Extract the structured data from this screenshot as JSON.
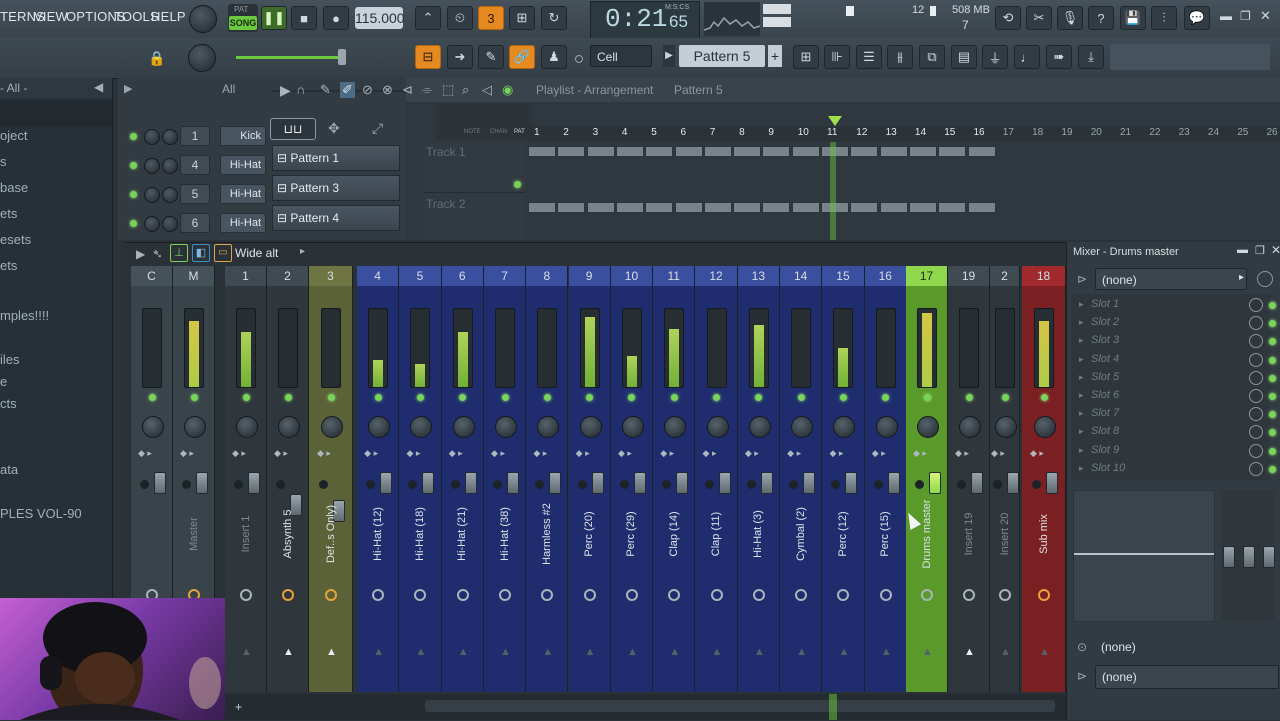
{
  "menu": [
    "TERNS",
    "VIEW",
    "OPTIONS",
    "TOOLS",
    "HELP"
  ],
  "transport": {
    "pat": "PAT",
    "song": "SONG",
    "tempo": "115.000",
    "time": "0:21",
    "time_sub": "65",
    "time_unit": "M:S:CS"
  },
  "cpu": {
    "val1": "12",
    "mem": "508 MB",
    "val2": "7"
  },
  "toolbar2": {
    "snap": "Cell",
    "pattern": "Pattern 5",
    "plus": "+"
  },
  "browser": {
    "header": "- All -",
    "items": [
      "oject",
      "s",
      "base",
      "ets",
      "esets",
      "ets",
      "mples!!!!",
      "iles",
      "e",
      "cts",
      "ata",
      "PLES VOL-90"
    ]
  },
  "rack": {
    "filter": "All",
    "channels": [
      {
        "num": "1",
        "name": "Kick"
      },
      {
        "num": "4",
        "name": "Hi-Hat"
      },
      {
        "num": "5",
        "name": "Hi-Hat"
      },
      {
        "num": "6",
        "name": "Hi-Hat"
      }
    ]
  },
  "patterns": [
    "Pattern 1",
    "Pattern 3",
    "Pattern 4"
  ],
  "playlist": {
    "title": "Playlist - Arrangement",
    "pattern": "Pattern 5",
    "tracks": [
      "Track 1",
      "Track 2"
    ],
    "bars": [
      "1",
      "2",
      "3",
      "4",
      "5",
      "6",
      "7",
      "8",
      "9",
      "10",
      "11",
      "12",
      "13",
      "14",
      "15",
      "16",
      "17",
      "18",
      "19",
      "20",
      "21",
      "22",
      "23",
      "24",
      "25",
      "26"
    ],
    "mini": [
      "NOTE",
      "CHAN",
      "PAT"
    ]
  },
  "mixer": {
    "preset": "Wide alt",
    "title": "Mixer - Drums master",
    "fx_none": "(none)",
    "slots": [
      "Slot 1",
      "Slot 2",
      "Slot 3",
      "Slot 4",
      "Slot 5",
      "Slot 6",
      "Slot 7",
      "Slot 8",
      "Slot 9",
      "Slot 10"
    ],
    "out_none1": "(none)",
    "out_none2": "(none)",
    "tracks": [
      {
        "hdr": "C",
        "label": ""
      },
      {
        "hdr": "M",
        "label": "Master"
      },
      {
        "hdr": "1",
        "label": "Insert 1"
      },
      {
        "hdr": "2",
        "label": "Absynth 5"
      },
      {
        "hdr": "3",
        "label": "Def..s Only)"
      },
      {
        "hdr": "4",
        "label": "Hi-Hat (12)"
      },
      {
        "hdr": "5",
        "label": "Hi-Hat (18)"
      },
      {
        "hdr": "6",
        "label": "Hi-Hat (21)"
      },
      {
        "hdr": "7",
        "label": "Hi-Hat (38)"
      },
      {
        "hdr": "8",
        "label": "Harmless #2"
      },
      {
        "hdr": "9",
        "label": "Perc (20)"
      },
      {
        "hdr": "10",
        "label": "Perc (29)"
      },
      {
        "hdr": "11",
        "label": "Clap (14)"
      },
      {
        "hdr": "12",
        "label": "Clap (11)"
      },
      {
        "hdr": "13",
        "label": "Hi-Hat (3)"
      },
      {
        "hdr": "14",
        "label": "Cymbal (2)"
      },
      {
        "hdr": "15",
        "label": "Perc (12)"
      },
      {
        "hdr": "16",
        "label": "Perc (15)"
      },
      {
        "hdr": "17",
        "label": "Drums master"
      },
      {
        "hdr": "19",
        "label": "Insert 19"
      },
      {
        "hdr": "2",
        "label": "Insert 20"
      },
      {
        "hdr": "18",
        "label": "Sub mix"
      }
    ]
  }
}
